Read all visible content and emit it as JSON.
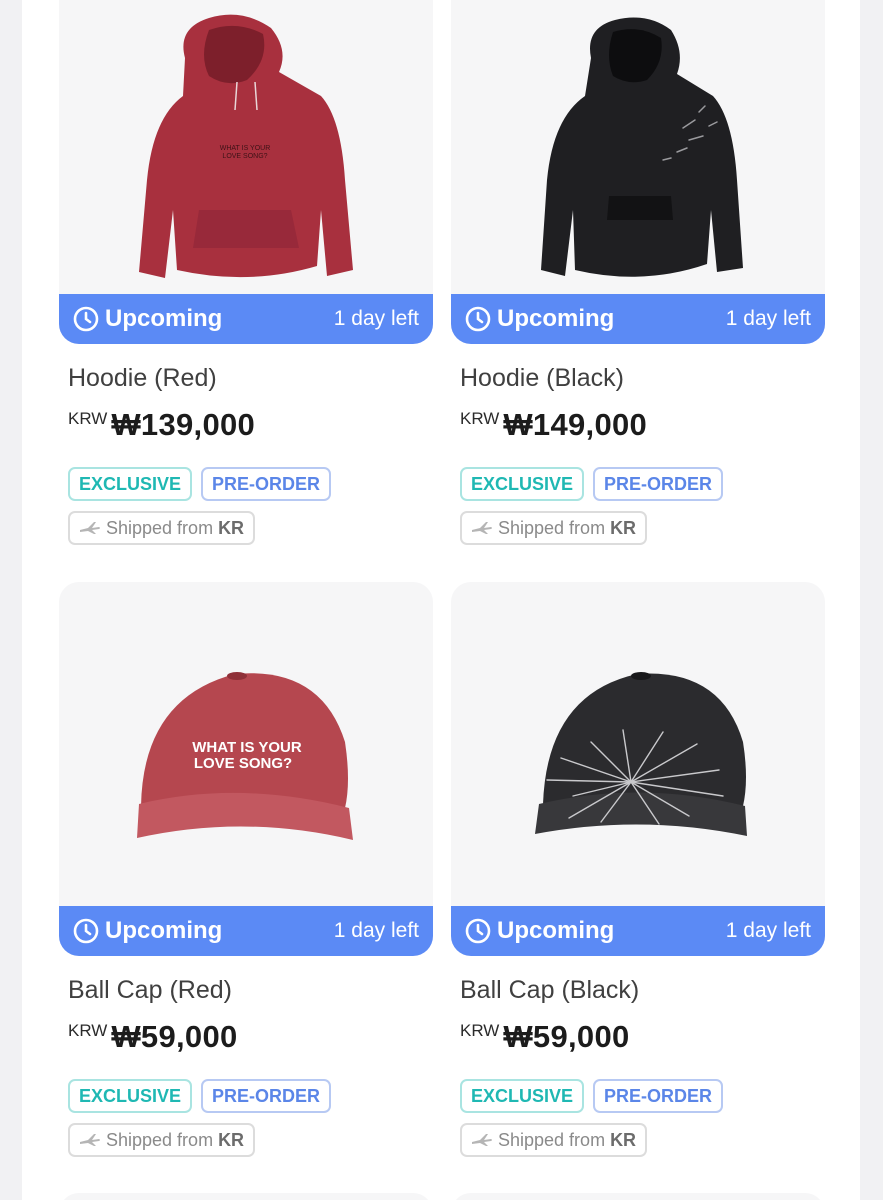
{
  "products": [
    {
      "name": "Hoodie (Red)",
      "currency": "KRW",
      "price": "₩139,000",
      "status": "Upcoming",
      "time_left": "1 day left",
      "tags": [
        "EXCLUSIVE",
        "PRE-ORDER"
      ],
      "shipping_prefix": "Shipped from",
      "shipping_origin": "KR",
      "image": "red-hoodie",
      "print_text": "WHAT IS YOUR LOVE SONG?"
    },
    {
      "name": "Hoodie (Black)",
      "currency": "KRW",
      "price": "₩149,000",
      "status": "Upcoming",
      "time_left": "1 day left",
      "tags": [
        "EXCLUSIVE",
        "PRE-ORDER"
      ],
      "shipping_prefix": "Shipped from",
      "shipping_origin": "KR",
      "image": "black-hoodie"
    },
    {
      "name": "Ball Cap (Red)",
      "currency": "KRW",
      "price": "₩59,000",
      "status": "Upcoming",
      "time_left": "1 day left",
      "tags": [
        "EXCLUSIVE",
        "PRE-ORDER"
      ],
      "shipping_prefix": "Shipped from",
      "shipping_origin": "KR",
      "image": "red-cap",
      "print_text": "WHAT IS YOUR LOVE SONG?"
    },
    {
      "name": "Ball Cap (Black)",
      "currency": "KRW",
      "price": "₩59,000",
      "status": "Upcoming",
      "time_left": "1 day left",
      "tags": [
        "EXCLUSIVE",
        "PRE-ORDER"
      ],
      "shipping_prefix": "Shipped from",
      "shipping_origin": "KR",
      "image": "black-cap"
    }
  ],
  "icons": {
    "status": "clock-icon",
    "shipping": "airplane-icon"
  },
  "colors": {
    "status_bar": "#5b8af5",
    "exclusive": "#1fb8b3",
    "preorder": "#5b86e8"
  }
}
